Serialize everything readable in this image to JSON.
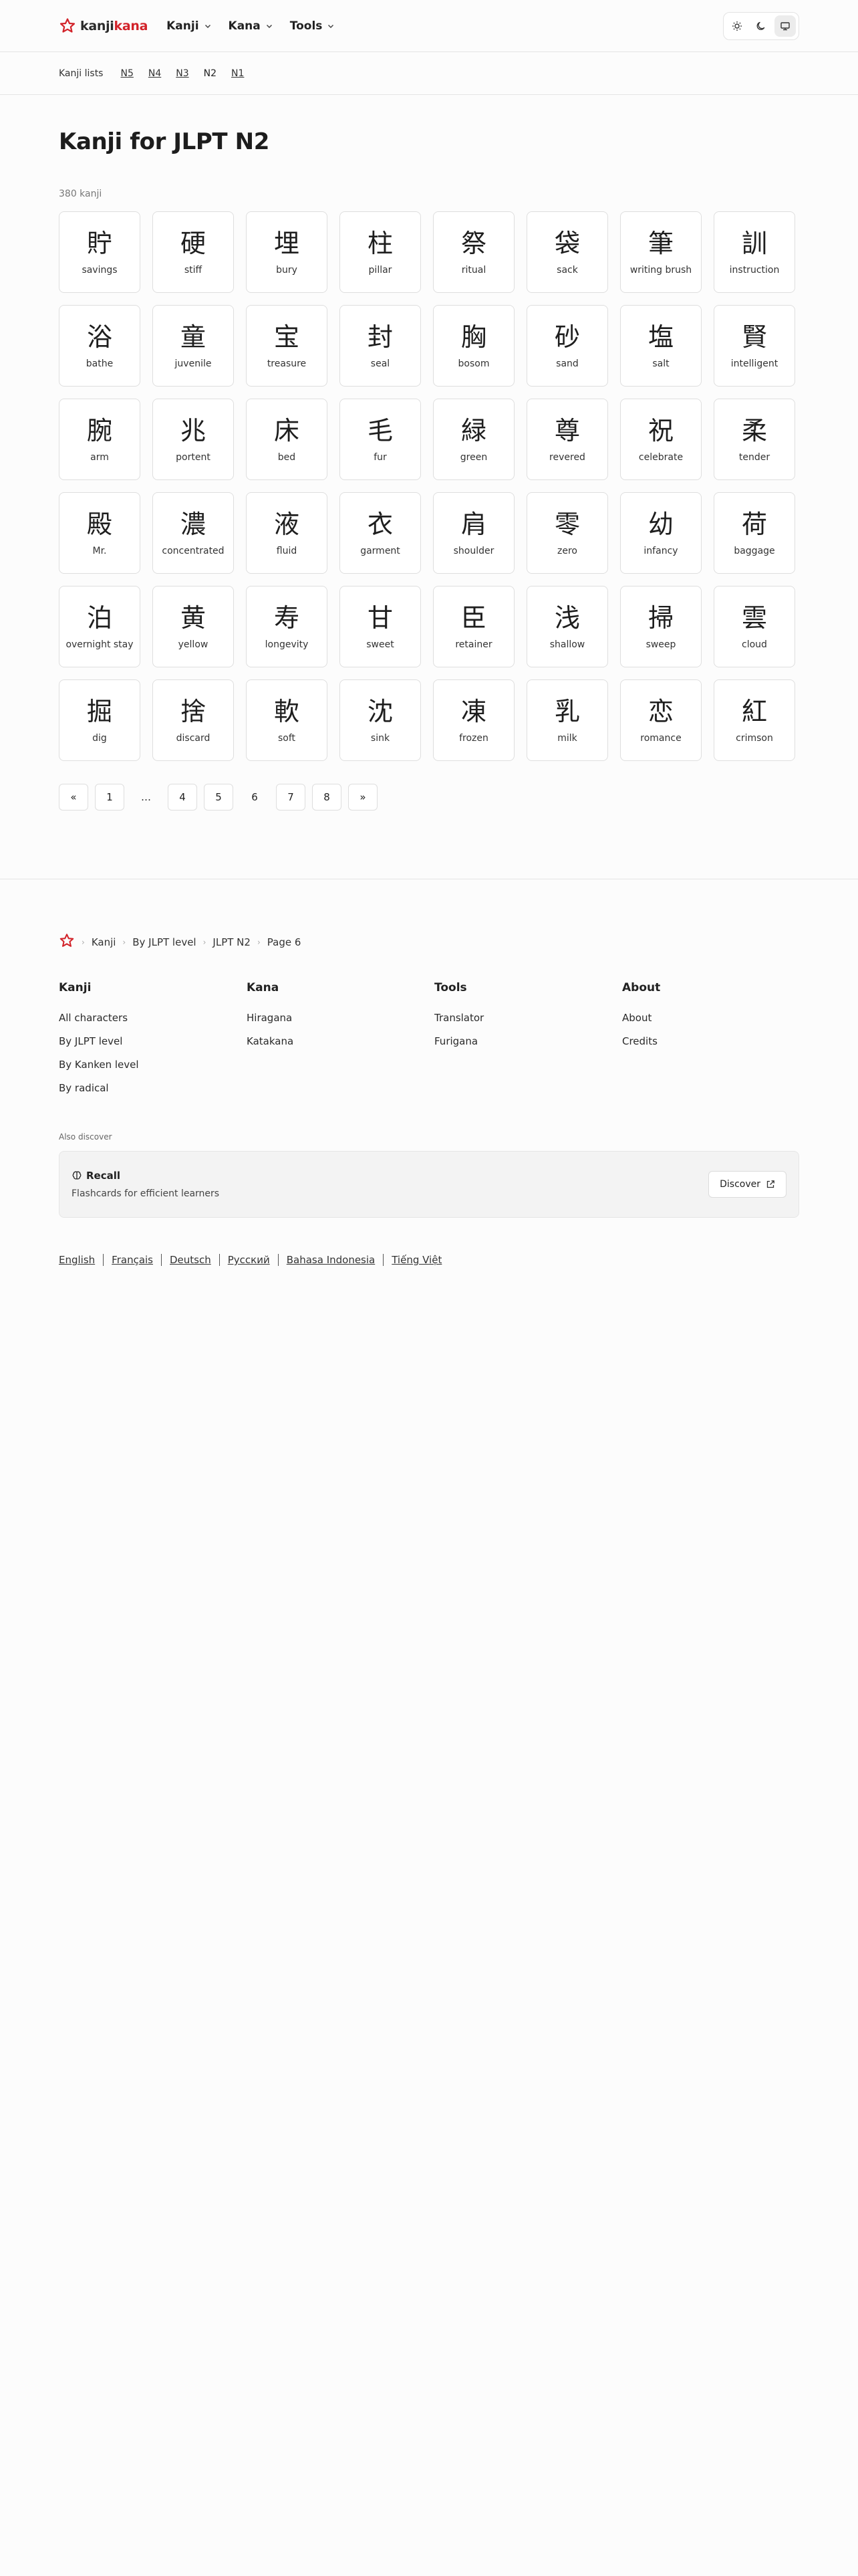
{
  "header": {
    "logo_a": "kanji",
    "logo_b": "kana",
    "nav": [
      "Kanji",
      "Kana",
      "Tools"
    ]
  },
  "subnav": {
    "title": "Kanji lists",
    "levels": [
      "N5",
      "N4",
      "N3",
      "N2",
      "N1"
    ],
    "current": "N2"
  },
  "main": {
    "title": "Kanji for JLPT N2",
    "count": "380 kanji",
    "kanji": [
      {
        "k": "貯",
        "m": "savings"
      },
      {
        "k": "硬",
        "m": "stiff"
      },
      {
        "k": "埋",
        "m": "bury"
      },
      {
        "k": "柱",
        "m": "pillar"
      },
      {
        "k": "祭",
        "m": "ritual"
      },
      {
        "k": "袋",
        "m": "sack"
      },
      {
        "k": "筆",
        "m": "writing brush"
      },
      {
        "k": "訓",
        "m": "instruction"
      },
      {
        "k": "浴",
        "m": "bathe"
      },
      {
        "k": "童",
        "m": "juvenile"
      },
      {
        "k": "宝",
        "m": "treasure"
      },
      {
        "k": "封",
        "m": "seal"
      },
      {
        "k": "胸",
        "m": "bosom"
      },
      {
        "k": "砂",
        "m": "sand"
      },
      {
        "k": "塩",
        "m": "salt"
      },
      {
        "k": "賢",
        "m": "intelligent"
      },
      {
        "k": "腕",
        "m": "arm"
      },
      {
        "k": "兆",
        "m": "portent"
      },
      {
        "k": "床",
        "m": "bed"
      },
      {
        "k": "毛",
        "m": "fur"
      },
      {
        "k": "緑",
        "m": "green"
      },
      {
        "k": "尊",
        "m": "revered"
      },
      {
        "k": "祝",
        "m": "celebrate"
      },
      {
        "k": "柔",
        "m": "tender"
      },
      {
        "k": "殿",
        "m": "Mr."
      },
      {
        "k": "濃",
        "m": "concentrated"
      },
      {
        "k": "液",
        "m": "fluid"
      },
      {
        "k": "衣",
        "m": "garment"
      },
      {
        "k": "肩",
        "m": "shoulder"
      },
      {
        "k": "零",
        "m": "zero"
      },
      {
        "k": "幼",
        "m": "infancy"
      },
      {
        "k": "荷",
        "m": "baggage"
      },
      {
        "k": "泊",
        "m": "overnight stay"
      },
      {
        "k": "黄",
        "m": "yellow"
      },
      {
        "k": "寿",
        "m": "longevity"
      },
      {
        "k": "甘",
        "m": "sweet"
      },
      {
        "k": "臣",
        "m": "retainer"
      },
      {
        "k": "浅",
        "m": "shallow"
      },
      {
        "k": "掃",
        "m": "sweep"
      },
      {
        "k": "雲",
        "m": "cloud"
      },
      {
        "k": "掘",
        "m": "dig"
      },
      {
        "k": "捨",
        "m": "discard"
      },
      {
        "k": "軟",
        "m": "soft"
      },
      {
        "k": "沈",
        "m": "sink"
      },
      {
        "k": "凍",
        "m": "frozen"
      },
      {
        "k": "乳",
        "m": "milk"
      },
      {
        "k": "恋",
        "m": "romance"
      },
      {
        "k": "紅",
        "m": "crimson"
      }
    ]
  },
  "pagination": {
    "prev": "«",
    "next": "»",
    "items": [
      "1",
      "…",
      "4",
      "5",
      "6",
      "7",
      "8"
    ],
    "current": "6"
  },
  "footer": {
    "breadcrumb": [
      "Kanji",
      "By JLPT level",
      "JLPT N2",
      "Page 6"
    ],
    "columns": [
      {
        "title": "Kanji",
        "links": [
          "All characters",
          "By JLPT level",
          "By Kanken level",
          "By radical"
        ]
      },
      {
        "title": "Kana",
        "links": [
          "Hiragana",
          "Katakana"
        ]
      },
      {
        "title": "Tools",
        "links": [
          "Translator",
          "Furigana"
        ]
      },
      {
        "title": "About",
        "links": [
          "About",
          "Credits"
        ]
      }
    ],
    "also_discover": "Also discover",
    "recall": {
      "title": "Recall",
      "subtitle": "Flashcards for efficient learners",
      "button": "Discover"
    },
    "languages": [
      "English",
      "Français",
      "Deutsch",
      "Русский",
      "Bahasa Indonesia",
      "Tiếng Việt"
    ]
  },
  "colors": {
    "brand": "#d2232a",
    "background": "#fcfcfc",
    "border": "#dedede"
  }
}
